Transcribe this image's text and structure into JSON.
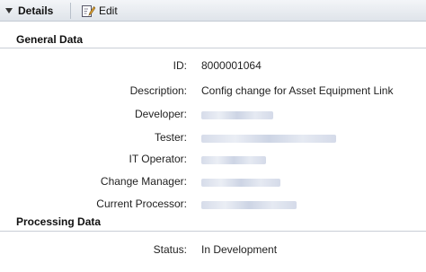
{
  "toolbar": {
    "details_label": "Details",
    "edit_label": "Edit"
  },
  "sections": {
    "general": {
      "title": "General Data",
      "fields": {
        "id": {
          "label": "ID:",
          "value": "8000001064"
        },
        "description": {
          "label": "Description:",
          "value": "Config change for Asset Equipment Link"
        },
        "developer": {
          "label": "Developer:"
        },
        "tester": {
          "label": "Tester:"
        },
        "it_operator": {
          "label": "IT Operator:"
        },
        "change_manager": {
          "label": "Change Manager:"
        },
        "current_processor": {
          "label": "Current Processor:"
        }
      }
    },
    "processing": {
      "title": "Processing Data",
      "fields": {
        "status": {
          "label": "Status:",
          "value": "In Development"
        }
      }
    }
  },
  "icons": {
    "toggle": "triangle-down-icon",
    "edit": "edit-pencil-icon"
  }
}
